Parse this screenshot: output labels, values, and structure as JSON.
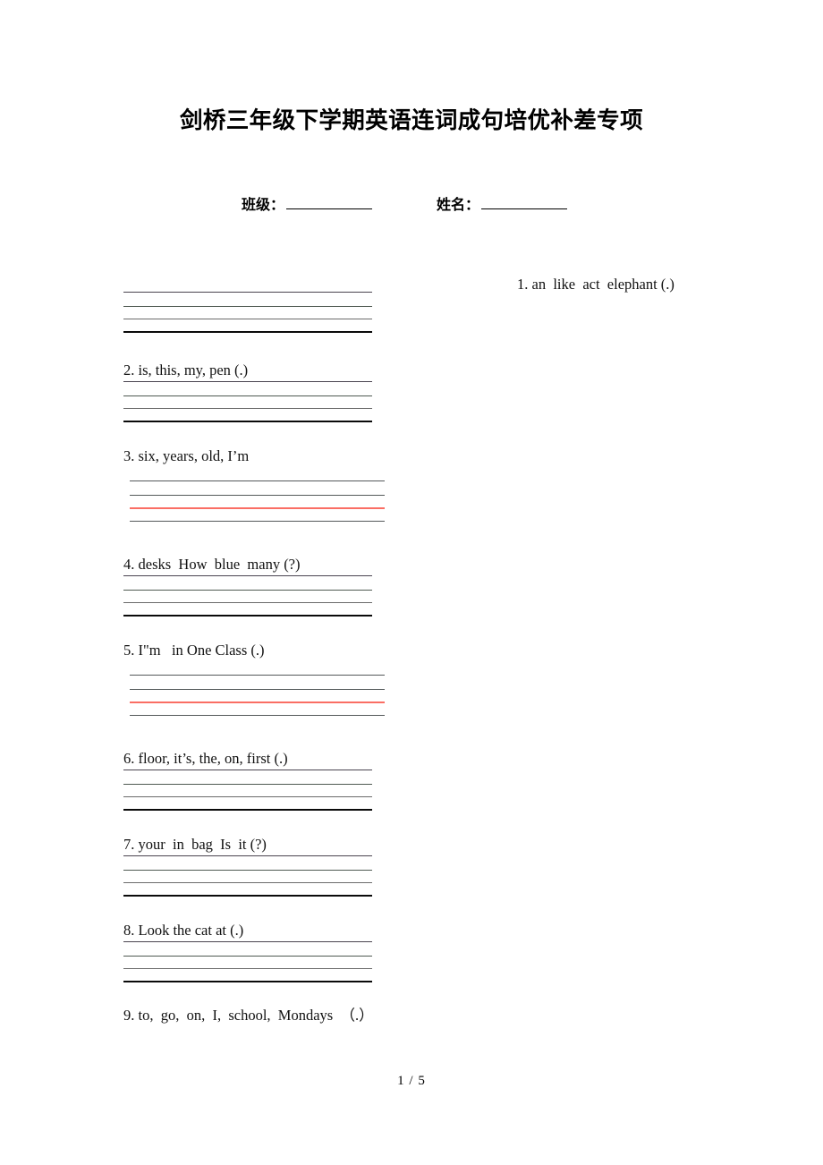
{
  "document": {
    "title": "剑桥三年级下学期英语连词成句培优补差专项",
    "footer_page": "1 / 5"
  },
  "header_fields": {
    "class_label": "班级：",
    "name_label": "姓名："
  },
  "questions": [
    {
      "number": "1.",
      "text": "1. an  like  act  elephant (.)"
    },
    {
      "number": "2.",
      "text": "2. is, this, my, pen (.)"
    },
    {
      "number": "3.",
      "text": "3. six, years, old, I’m"
    },
    {
      "number": "4.",
      "text": "4. desks  How  blue  many (?)"
    },
    {
      "number": "5.",
      "text": "5. I\"m   in One Class (.)"
    },
    {
      "number": "6.",
      "text": "6. floor, it’s, the, on, first (.)"
    },
    {
      "number": "7.",
      "text": "7. your  in  bag  Is  it (?)"
    },
    {
      "number": "8.",
      "text": "8. Look the cat at (.)"
    },
    {
      "number": "9.",
      "text": "9. to,  go,  on,  I,  school,  Mondays  （.）"
    }
  ],
  "colors": {
    "red_rule": "#fa6e64",
    "black_rule": "#0a0a0a",
    "grey_rule": "#54595a",
    "text": "#111111",
    "page_background": "#ffffff"
  }
}
